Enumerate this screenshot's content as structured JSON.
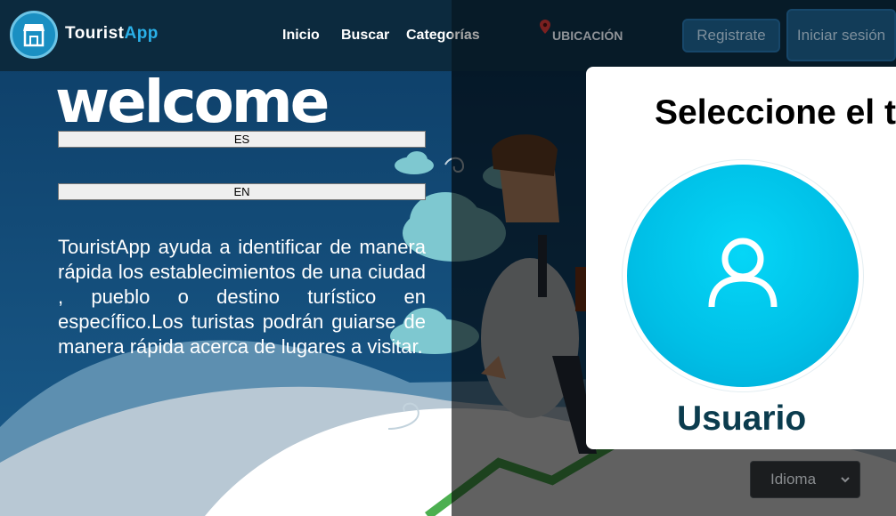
{
  "brand": {
    "name_main": "Tourist",
    "name_accent": "App"
  },
  "nav": {
    "links": [
      "Inicio",
      "Buscar",
      "Categorías"
    ],
    "location": "UBICACIÓN",
    "register": "Registrate",
    "login": "Iniciar sesión"
  },
  "hero": {
    "welcome": "welcome",
    "lang_es": "ES",
    "lang_en": "EN",
    "description": "TouristApp ayuda a identificar de manera rápida los establecimientos de una ciudad , pueblo o destino turístico en específico.Los turistas podrán guiarse de manera rápida acerca de lugares a visitar."
  },
  "modal": {
    "title": "Seleccione el tipo de usuario",
    "option_label": "Usuario"
  },
  "footer": {
    "language_select": "Idioma"
  },
  "colors": {
    "navbar": "#0c2a3e",
    "accent": "#2ab0e8",
    "circle": "#00bfe6",
    "user_label": "#0b3c4e"
  }
}
